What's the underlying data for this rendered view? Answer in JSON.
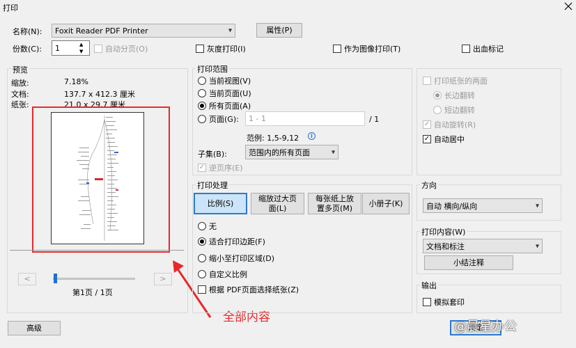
{
  "window": {
    "title": "打印",
    "close_icon": "close-icon"
  },
  "printer": {
    "name_label": "名称(N):",
    "name_value": "Foxit Reader PDF Printer",
    "properties_label": "属性(P)",
    "copies_label": "份数(C):",
    "copies_value": "1",
    "collate_label": "自动分页(O)",
    "grayscale_label": "灰度打印(I)",
    "print_as_image_label": "作为图像打印(T)",
    "bleed_marks_label": "出血标记"
  },
  "preview": {
    "title": "预览",
    "zoom_label": "缩放:",
    "zoom_value": "7.18%",
    "document_label": "文档:",
    "document_value": "137.7 x 412.3 厘米",
    "paper_label": "纸张:",
    "paper_value": "21.0 x 29.7 厘米",
    "prev_button": "<",
    "next_button": ">",
    "page_indicator": "第1页 / 1页"
  },
  "print_range": {
    "title": "打印范围",
    "current_view": "当前视图(V)",
    "current_page": "当前页面(U)",
    "all_pages": "所有页面(A)",
    "pages_label": "页面(G):",
    "pages_placeholder": "1 - 1",
    "pages_total": "/ 1",
    "example": "范例: 1,5-9,12",
    "subset_label": "子集(B):",
    "subset_value": "范围内的所有页面",
    "reverse_label": "逆页序(E)"
  },
  "duplex": {
    "both_sides": "打印纸张的两面",
    "long_edge": "长边翻转",
    "short_edge": "短边翻转",
    "auto_rotate": "自动旋转(R)",
    "auto_center": "自动居中"
  },
  "handling": {
    "title": "打印处理",
    "tabs": [
      "比例(S)",
      "缩放过大页面(L)",
      "每张纸上放置多页(M)",
      "小册子(K)"
    ],
    "none": "无",
    "fit_margins": "适合打印边距(F)",
    "shrink_area": "缩小至打印区域(D)",
    "custom_scale": "自定义比例",
    "choose_paper": "根据 PDF页面选择纸张(Z)"
  },
  "orientation": {
    "title": "方向",
    "value": "自动 横向/纵向"
  },
  "content": {
    "title": "打印内容(W)",
    "value": "文档和标注",
    "summarize_button": "小结注释"
  },
  "output": {
    "title": "输出",
    "simulate_overprint": "模拟套印"
  },
  "footer": {
    "advanced_button": "高级",
    "ok_button": "确定"
  },
  "annotation": {
    "text": "全部内容",
    "color": "#e8282b"
  },
  "watermark": {
    "text": "@晨星办公"
  }
}
